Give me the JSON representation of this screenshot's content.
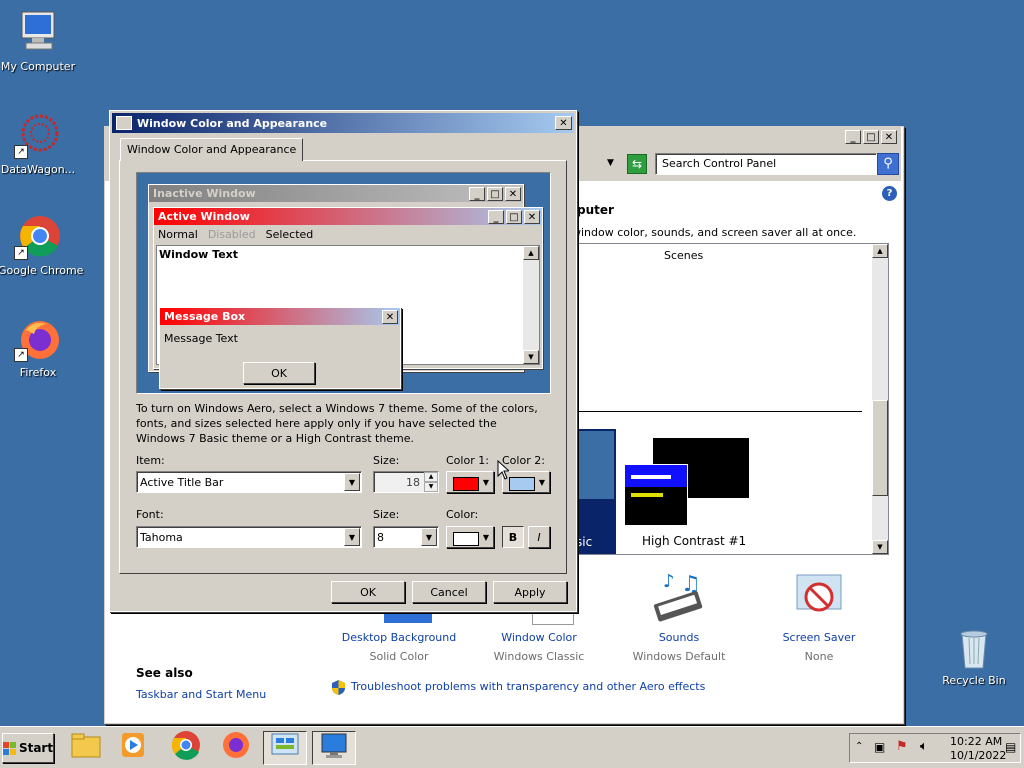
{
  "desktop": {
    "icons": [
      {
        "label": "My Computer"
      },
      {
        "label": "DataWagon..."
      },
      {
        "label": "Google Chrome"
      },
      {
        "label": "Firefox"
      },
      {
        "label": "Recycle Bin"
      }
    ]
  },
  "control_panel": {
    "search_placeholder": "Search Control Panel",
    "heading_partial": "puter",
    "desc_partial": "window color, sounds, and screen saver all at once.",
    "scenes_label": "Scenes",
    "theme_name_partial": "sic",
    "high_contrast_name": "High Contrast #1",
    "items": [
      {
        "title": "Desktop Background",
        "sub": "Solid Color"
      },
      {
        "title": "Window Color",
        "sub": "Windows Classic"
      },
      {
        "title": "Sounds",
        "sub": "Windows Default"
      },
      {
        "title": "Screen Saver",
        "sub": "None"
      }
    ],
    "see_also_title": "See also",
    "see_also_link": "Taskbar and Start Menu",
    "troubleshoot_link": "Troubleshoot problems with transparency and other Aero effects"
  },
  "dialog": {
    "title": "Window Color and Appearance",
    "tab_label": "Window Color and Appearance",
    "preview": {
      "inactive_title": "Inactive Window",
      "active_title": "Active Window",
      "menu_normal": "Normal",
      "menu_disabled": "Disabled",
      "menu_selected": "Selected",
      "window_text": "Window Text",
      "msgbox_title": "Message Box",
      "msgbox_text": "Message Text",
      "msgbox_ok": "OK"
    },
    "info_text": "To turn on Windows Aero, select a Windows 7 theme.  Some of the colors, fonts, and sizes selected here apply only if you have selected the Windows 7 Basic theme or a High Contrast theme.",
    "item_label": "Item:",
    "item_value": "Active Title Bar",
    "size_label": "Size:",
    "size_value": "18",
    "color1_label": "Color 1:",
    "color2_label": "Color 2:",
    "color1": "#ff0000",
    "color2": "#a6caf0",
    "font_label": "Font:",
    "font_value": "Tahoma",
    "font_size_label": "Size:",
    "font_size_value": "8",
    "font_color_label": "Color:",
    "font_color": "#ffffff",
    "bold_label": "B",
    "italic_label": "I",
    "ok": "OK",
    "cancel": "Cancel",
    "apply": "Apply"
  },
  "taskbar": {
    "start_label": "Start",
    "time": "10:22 AM",
    "date": "10/1/2022"
  }
}
